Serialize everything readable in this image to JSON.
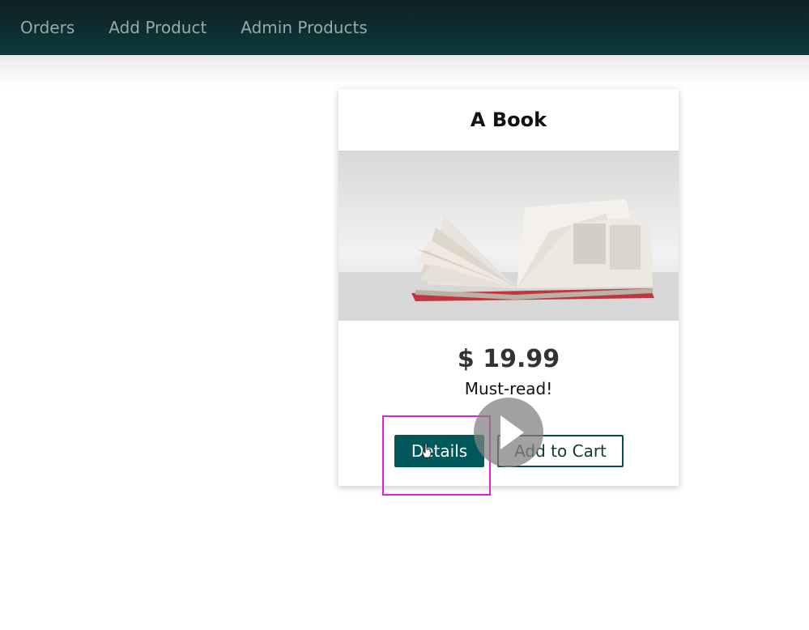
{
  "nav": {
    "items": [
      {
        "label": "Orders"
      },
      {
        "label": "Add Product"
      },
      {
        "label": "Admin Products"
      }
    ]
  },
  "product": {
    "title": "A Book",
    "image_icon": "open-book-photo",
    "price": "$ 19.99",
    "description": "Must-read!",
    "details_label": "Details",
    "add_to_cart_label": "Add to Cart"
  },
  "overlay": {
    "play_icon": "play-icon",
    "highlight_color": "#e51fd6"
  },
  "colors": {
    "header_dark": "#0f1f22",
    "header_teal": "#0a3b3d",
    "button_primary": "#00585a"
  }
}
